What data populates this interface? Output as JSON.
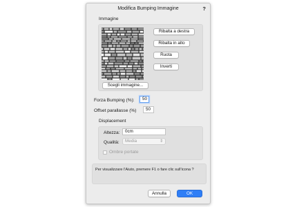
{
  "dialog": {
    "title": "Modifica Bumping Immagine",
    "help_glyph": "?"
  },
  "image_group": {
    "label": "Immagine",
    "buttons": {
      "flip_horizontal": "Ribalta a destra",
      "flip_vertical": "Ribalta in alto",
      "rotate": "Ruota",
      "invert": "Inverti",
      "choose_image": "Scegli immagine..."
    }
  },
  "fields": {
    "bump_strength": {
      "label": "Forza Bumping (%):",
      "value": "50"
    },
    "parallax_offset": {
      "label": "Offset parallasse (%)",
      "value": "50"
    }
  },
  "displacement": {
    "label": "Displacement",
    "height": {
      "label": "Altezza:",
      "value": "0cm"
    },
    "quality": {
      "label": "Qualità:",
      "value": "Media"
    },
    "cast_shadows": {
      "label": "Ombre portate",
      "checked": false
    }
  },
  "help_text": "Per visualizzare l'Aiuto, premere F1 o fare clic sull'icona ?",
  "footer": {
    "cancel_label": "Annulla",
    "ok_label": "OK"
  },
  "colors": {
    "accent": "#2f7ef6",
    "dialog_bg": "#ececec",
    "group_bg": "#e0e0e0"
  },
  "icons": {
    "help": "question-mark-icon",
    "quality_select": "chevron-updown-icon"
  }
}
